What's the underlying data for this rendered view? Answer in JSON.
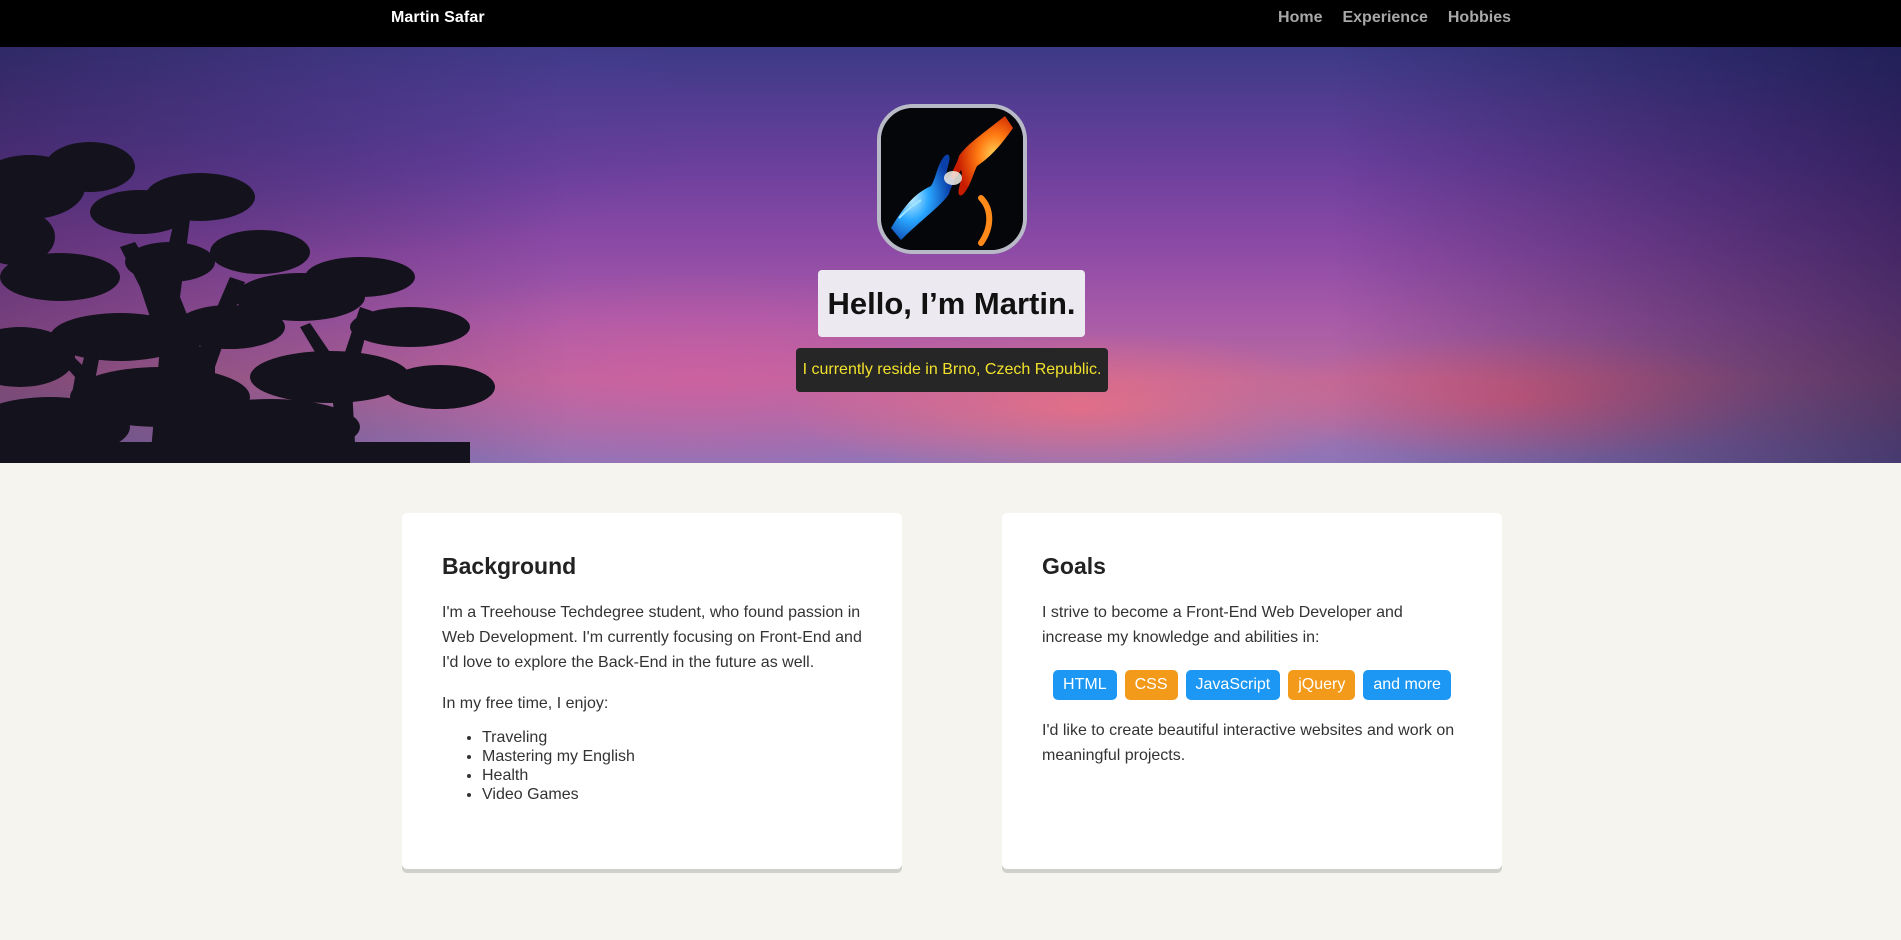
{
  "header": {
    "brand": "Martin Safar",
    "nav": [
      "Home",
      "Experience",
      "Hobbies"
    ]
  },
  "hero": {
    "avatar_icon": "fire-and-ice-hands-icon",
    "title": "Hello, I’m Martin.",
    "subtitle": "I currently reside in Brno, Czech Republic."
  },
  "background": {
    "heading": "Background",
    "intro": "I'm a Treehouse Techdegree student, who found passion in Web Development. I'm currently focusing on Front-End and I'd love to explore the Back-End in the future as well.",
    "free_time": "In my free time, I enjoy:",
    "hobbies": [
      "Traveling",
      "Mastering my English",
      "Health",
      "Video Games"
    ]
  },
  "goals": {
    "heading": "Goals",
    "intro": "I strive to become a Front-End Web Developer and increase my knowledge and abilities in:",
    "tags": [
      {
        "label": "HTML",
        "color": "#1c97f3"
      },
      {
        "label": "CSS",
        "color": "#f39a1b"
      },
      {
        "label": "JavaScript",
        "color": "#1c97f3"
      },
      {
        "label": "jQuery",
        "color": "#f39a1b"
      },
      {
        "label": "and more",
        "color": "#1c97f3"
      }
    ],
    "outro": "I'd like to create beautiful interactive websites and work on meaningful projects."
  },
  "colors": {
    "topbar": "#000000",
    "page_bg": "#f5f4ef",
    "subtitle_text": "#f1e12c",
    "tag_blue": "#1c97f3",
    "tag_orange": "#f39a1b"
  }
}
